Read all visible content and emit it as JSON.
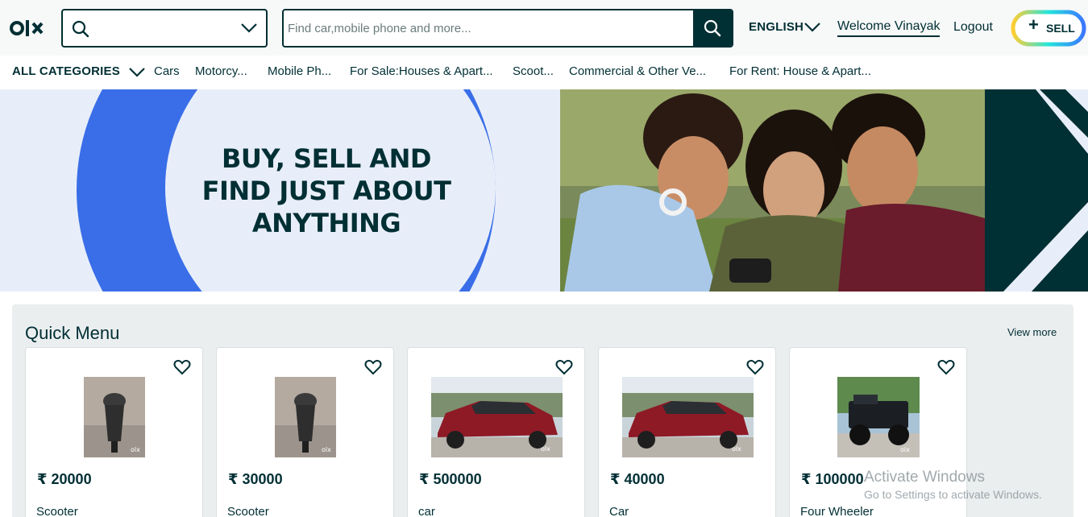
{
  "header": {
    "logo_text": "olx",
    "location_value": "",
    "search_placeholder": "Find car,mobile phone and more...",
    "language": "ENGLISH",
    "welcome": "Welcome Vinayak",
    "logout": "Logout",
    "sell_label": "SELL"
  },
  "categories": {
    "all_label": "ALL CATEGORIES",
    "items": [
      "Cars",
      "Motorcy...",
      "Mobile Ph...",
      "For Sale:Houses & Apart...",
      "Scoot...",
      "Commercial & Other Ve...",
      "For Rent: House & Apart..."
    ]
  },
  "banner": {
    "line1": "BUY, SELL AND",
    "line2": "FIND JUST ABOUT",
    "line3": "ANYTHING"
  },
  "quick_menu": {
    "title": "Quick Menu",
    "view_more": "View more",
    "cards": [
      {
        "price": "₹ 20000",
        "title": "Scooter",
        "image": "scooter-photo"
      },
      {
        "price": "₹ 30000",
        "title": "Scooter",
        "image": "scooter-photo"
      },
      {
        "price": "₹ 500000",
        "title": "car",
        "image": "car-photo"
      },
      {
        "price": "₹ 40000",
        "title": "Car",
        "image": "car-photo"
      },
      {
        "price": "₹ 100000",
        "title": "Four Wheeler",
        "image": "jeep-photo"
      }
    ]
  },
  "watermark": {
    "line1": "Activate Windows",
    "line2": "Go to Settings to activate Windows."
  },
  "colors": {
    "primary": "#002f34",
    "banner_blue": "#3a77ff",
    "banner_light": "#e8eef9",
    "sell_yellow": "#ffce32",
    "sell_cyan": "#23e5db",
    "sell_blue": "#3a77ff"
  }
}
